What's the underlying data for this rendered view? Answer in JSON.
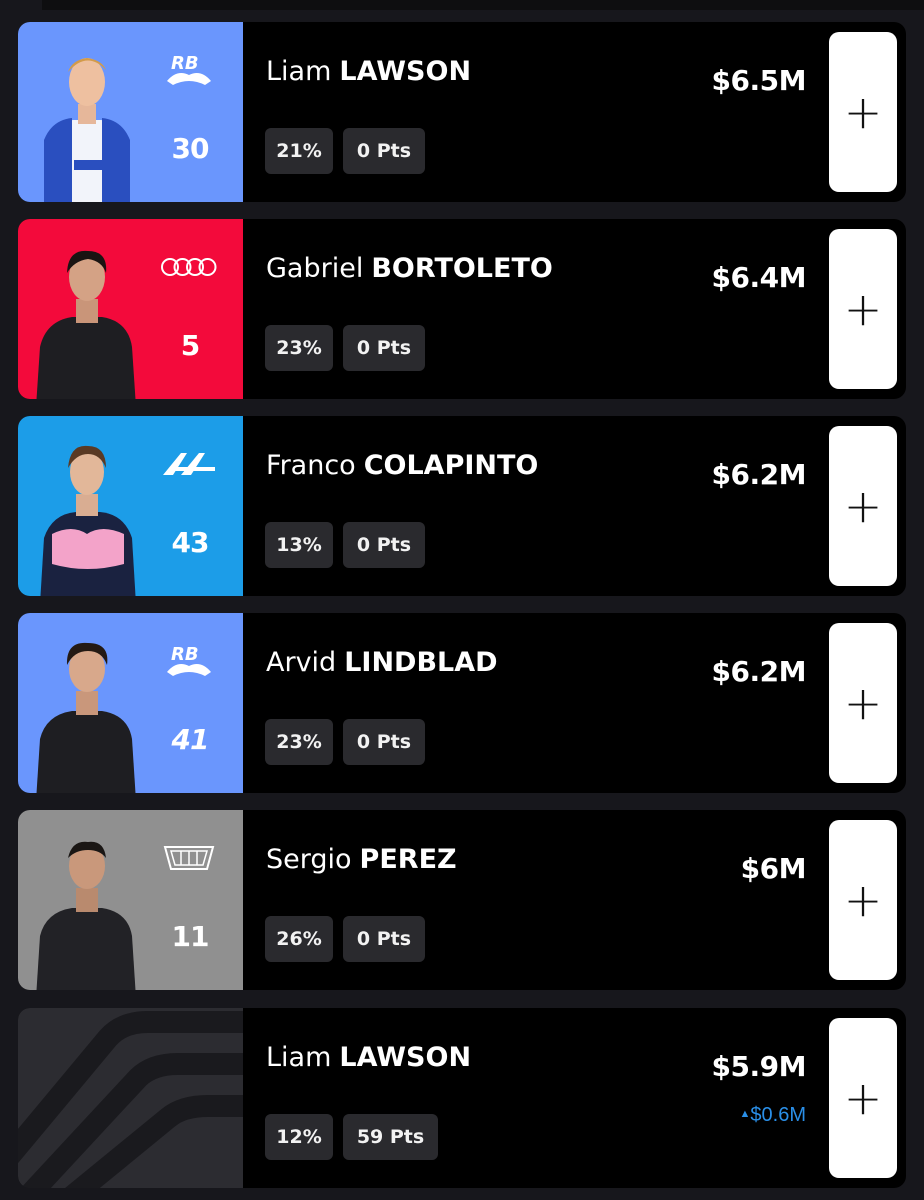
{
  "drivers": [
    {
      "first": "Liam",
      "last": "LAWSON",
      "number": "30",
      "team_logo": "racing-bulls-logo",
      "panel_color": "#6a96fd",
      "selected_pct": "21%",
      "points": "0 Pts",
      "price": "$6.5M",
      "price_delta": ""
    },
    {
      "first": "Gabriel",
      "last": "BORTOLETO",
      "number": "5",
      "team_logo": "audi-rings-logo",
      "panel_color": "#f30a3b",
      "selected_pct": "23%",
      "points": "0 Pts",
      "price": "$6.4M",
      "price_delta": ""
    },
    {
      "first": "Franco",
      "last": "COLAPINTO",
      "number": "43",
      "team_logo": "alpine-logo",
      "panel_color": "#1c9de8",
      "selected_pct": "13%",
      "points": "0 Pts",
      "price": "$6.2M",
      "price_delta": ""
    },
    {
      "first": "Arvid",
      "last": "LINDBLAD",
      "number": "41",
      "team_logo": "racing-bulls-logo",
      "panel_color": "#6a96fd",
      "selected_pct": "23%",
      "points": "0 Pts",
      "price": "$6.2M",
      "price_delta": ""
    },
    {
      "first": "Sergio",
      "last": "PEREZ",
      "number": "11",
      "team_logo": "cadillac-logo",
      "panel_color": "#909090",
      "selected_pct": "26%",
      "points": "0 Pts",
      "price": "$6M",
      "price_delta": ""
    },
    {
      "first": "Liam",
      "last": "LAWSON",
      "number": "",
      "team_logo": "placeholder-pattern",
      "panel_color": "#2c2c31",
      "selected_pct": "12%",
      "points": "59 Pts",
      "price": "$5.9M",
      "price_delta": "$0.6M"
    }
  ],
  "add_button_icon": "plus-icon"
}
